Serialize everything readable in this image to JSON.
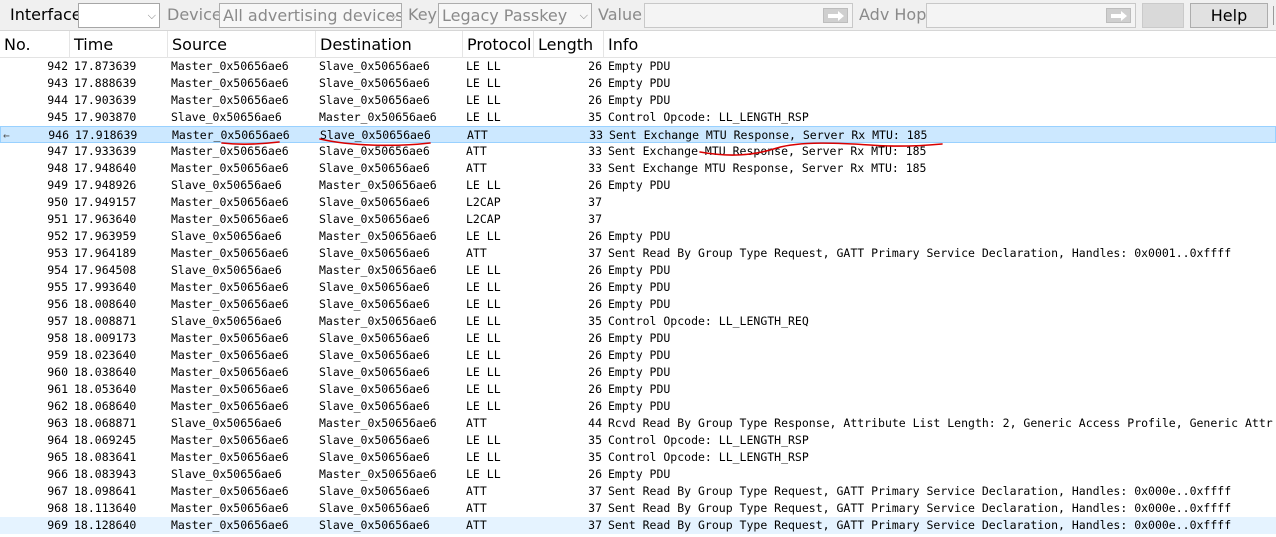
{
  "toolbar": {
    "interface_label": "Interface",
    "interface_value": "",
    "device_label": "Device",
    "device_value": "All advertising devices",
    "key_label": "Key",
    "key_value": "Legacy Passkey",
    "value_label": "Value",
    "value_text": "",
    "adv_hop_label": "Adv Hop",
    "adv_hop_text": "",
    "blank_button_label": "",
    "help_label": "Help"
  },
  "columns": {
    "no": "No.",
    "time": "Time",
    "source": "Source",
    "destination": "Destination",
    "protocol": "Protocol",
    "length": "Length",
    "info": "Info"
  },
  "related_marker": "←",
  "rows": [
    {
      "no": "942",
      "time": "17.873639",
      "src": "Master_0x50656ae6",
      "dst": "Slave_0x50656ae6",
      "proto": "LE LL",
      "len": "26",
      "info": "Empty PDU"
    },
    {
      "no": "943",
      "time": "17.888639",
      "src": "Master_0x50656ae6",
      "dst": "Slave_0x50656ae6",
      "proto": "LE LL",
      "len": "26",
      "info": "Empty PDU"
    },
    {
      "no": "944",
      "time": "17.903639",
      "src": "Master_0x50656ae6",
      "dst": "Slave_0x50656ae6",
      "proto": "LE LL",
      "len": "26",
      "info": "Empty PDU"
    },
    {
      "no": "945",
      "time": "17.903870",
      "src": "Slave_0x50656ae6",
      "dst": "Master_0x50656ae6",
      "proto": "LE LL",
      "len": "35",
      "info": "Control Opcode: LL_LENGTH_RSP"
    },
    {
      "no": "946",
      "time": "17.918639",
      "src": "Master_0x50656ae6",
      "dst": "Slave_0x50656ae6",
      "proto": "ATT",
      "len": "33",
      "info": "Sent Exchange MTU Response, Server Rx MTU: 185",
      "selected": true
    },
    {
      "no": "947",
      "time": "17.933639",
      "src": "Master_0x50656ae6",
      "dst": "Slave_0x50656ae6",
      "proto": "ATT",
      "len": "33",
      "info": "Sent Exchange MTU Response, Server Rx MTU: 185"
    },
    {
      "no": "948",
      "time": "17.948640",
      "src": "Master_0x50656ae6",
      "dst": "Slave_0x50656ae6",
      "proto": "ATT",
      "len": "33",
      "info": "Sent Exchange MTU Response, Server Rx MTU: 185"
    },
    {
      "no": "949",
      "time": "17.948926",
      "src": "Slave_0x50656ae6",
      "dst": "Master_0x50656ae6",
      "proto": "LE LL",
      "len": "26",
      "info": "Empty PDU"
    },
    {
      "no": "950",
      "time": "17.949157",
      "src": "Master_0x50656ae6",
      "dst": "Slave_0x50656ae6",
      "proto": "L2CAP",
      "len": "37",
      "info": ""
    },
    {
      "no": "951",
      "time": "17.963640",
      "src": "Master_0x50656ae6",
      "dst": "Slave_0x50656ae6",
      "proto": "L2CAP",
      "len": "37",
      "info": ""
    },
    {
      "no": "952",
      "time": "17.963959",
      "src": "Slave_0x50656ae6",
      "dst": "Master_0x50656ae6",
      "proto": "LE LL",
      "len": "26",
      "info": "Empty PDU"
    },
    {
      "no": "953",
      "time": "17.964189",
      "src": "Master_0x50656ae6",
      "dst": "Slave_0x50656ae6",
      "proto": "ATT",
      "len": "37",
      "info": "Sent Read By Group Type Request, GATT Primary Service Declaration, Handles: 0x0001..0xffff"
    },
    {
      "no": "954",
      "time": "17.964508",
      "src": "Slave_0x50656ae6",
      "dst": "Master_0x50656ae6",
      "proto": "LE LL",
      "len": "26",
      "info": "Empty PDU"
    },
    {
      "no": "955",
      "time": "17.993640",
      "src": "Master_0x50656ae6",
      "dst": "Slave_0x50656ae6",
      "proto": "LE LL",
      "len": "26",
      "info": "Empty PDU"
    },
    {
      "no": "956",
      "time": "18.008640",
      "src": "Master_0x50656ae6",
      "dst": "Slave_0x50656ae6",
      "proto": "LE LL",
      "len": "26",
      "info": "Empty PDU"
    },
    {
      "no": "957",
      "time": "18.008871",
      "src": "Slave_0x50656ae6",
      "dst": "Master_0x50656ae6",
      "proto": "LE LL",
      "len": "35",
      "info": "Control Opcode: LL_LENGTH_REQ"
    },
    {
      "no": "958",
      "time": "18.009173",
      "src": "Master_0x50656ae6",
      "dst": "Slave_0x50656ae6",
      "proto": "LE LL",
      "len": "26",
      "info": "Empty PDU"
    },
    {
      "no": "959",
      "time": "18.023640",
      "src": "Master_0x50656ae6",
      "dst": "Slave_0x50656ae6",
      "proto": "LE LL",
      "len": "26",
      "info": "Empty PDU"
    },
    {
      "no": "960",
      "time": "18.038640",
      "src": "Master_0x50656ae6",
      "dst": "Slave_0x50656ae6",
      "proto": "LE LL",
      "len": "26",
      "info": "Empty PDU"
    },
    {
      "no": "961",
      "time": "18.053640",
      "src": "Master_0x50656ae6",
      "dst": "Slave_0x50656ae6",
      "proto": "LE LL",
      "len": "26",
      "info": "Empty PDU"
    },
    {
      "no": "962",
      "time": "18.068640",
      "src": "Master_0x50656ae6",
      "dst": "Slave_0x50656ae6",
      "proto": "LE LL",
      "len": "26",
      "info": "Empty PDU"
    },
    {
      "no": "963",
      "time": "18.068871",
      "src": "Slave_0x50656ae6",
      "dst": "Master_0x50656ae6",
      "proto": "ATT",
      "len": "44",
      "info": "Rcvd Read By Group Type Response, Attribute List Length: 2, Generic Access Profile, Generic Attr"
    },
    {
      "no": "964",
      "time": "18.069245",
      "src": "Master_0x50656ae6",
      "dst": "Slave_0x50656ae6",
      "proto": "LE LL",
      "len": "35",
      "info": "Control Opcode: LL_LENGTH_RSP"
    },
    {
      "no": "965",
      "time": "18.083641",
      "src": "Master_0x50656ae6",
      "dst": "Slave_0x50656ae6",
      "proto": "LE LL",
      "len": "35",
      "info": "Control Opcode: LL_LENGTH_RSP"
    },
    {
      "no": "966",
      "time": "18.083943",
      "src": "Slave_0x50656ae6",
      "dst": "Master_0x50656ae6",
      "proto": "LE LL",
      "len": "26",
      "info": "Empty PDU"
    },
    {
      "no": "967",
      "time": "18.098641",
      "src": "Master_0x50656ae6",
      "dst": "Slave_0x50656ae6",
      "proto": "ATT",
      "len": "37",
      "info": "Sent Read By Group Type Request, GATT Primary Service Declaration, Handles: 0x000e..0xffff"
    },
    {
      "no": "968",
      "time": "18.113640",
      "src": "Master_0x50656ae6",
      "dst": "Slave_0x50656ae6",
      "proto": "ATT",
      "len": "37",
      "info": "Sent Read By Group Type Request, GATT Primary Service Declaration, Handles: 0x000e..0xffff"
    },
    {
      "no": "969",
      "time": "18.128640",
      "src": "Master_0x50656ae6",
      "dst": "Slave_0x50656ae6",
      "proto": "ATT",
      "len": "37",
      "info": "Sent Read By Group Type Request, GATT Primary Service Declaration, Handles: 0x000e..0xffff",
      "hover": true
    }
  ],
  "colors": {
    "selected_row": "#cce8ff",
    "hover_row": "#e5f3ff",
    "annotation_ink": "#d80000"
  }
}
